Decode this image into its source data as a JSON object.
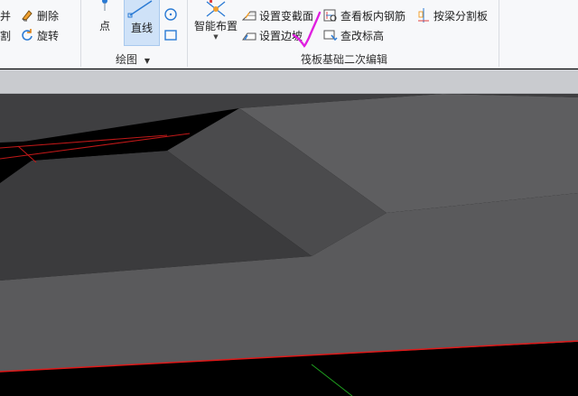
{
  "ribbon": {
    "left_group": {
      "merge_label": "并",
      "delete_label": "删除",
      "split_label": "割",
      "rotate_label": "旋转"
    },
    "draw_group": {
      "point_label": "点",
      "line_label": "直线",
      "group_label": "绘图"
    },
    "raft_group": {
      "smart_layout_label": "智能布置",
      "set_section_change_label": "设置变截面",
      "set_slope_label": "设置边坡",
      "view_rebar_label": "查看板内钢筋",
      "edit_elevation_label": "查改标高",
      "split_by_beam_label": "按梁分割板",
      "group_label": "筏板基础二次编辑"
    }
  },
  "colors": {
    "ribbon_bg": "#f7f8fa",
    "strip_bg": "#c9cbcf",
    "annotation_stroke": "#e020e0",
    "red_edge": "#e01818",
    "green_axis": "#1fa01f"
  }
}
